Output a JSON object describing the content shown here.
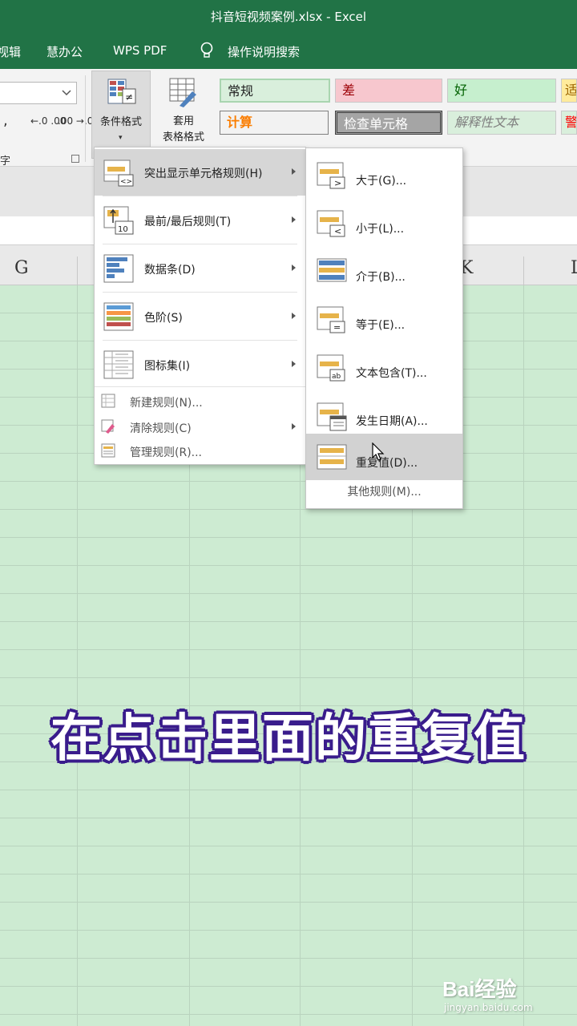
{
  "window": {
    "title": "抖音短视频案例.xlsx  -  Excel"
  },
  "menubar": {
    "items": [
      {
        "label": "视辑"
      },
      {
        "label": "慧办公"
      },
      {
        "label": "WPS PDF"
      },
      {
        "label": "操作说明搜索"
      }
    ]
  },
  "ribbon": {
    "number_group_label": "字",
    "comma_label": ",",
    "dec_increase": "←.0 .00",
    "dec_decrease": ".00 →.0",
    "conditional_format": {
      "label": "条件格式"
    },
    "table_format": {
      "label1": "套用",
      "label2": "表格格式"
    },
    "styles": [
      {
        "label": "常规",
        "bg": "#d9efdc",
        "color": "#222222"
      },
      {
        "label": "差",
        "bg": "#f7c7ce",
        "color": "#9c0006"
      },
      {
        "label": "好",
        "bg": "#c6efce",
        "color": "#006100"
      },
      {
        "label": "适",
        "bg": "#ffeb9c",
        "color": "#9c6500"
      },
      {
        "label": "计算",
        "bg": "#f2f2f2",
        "color": "#fa7d00"
      },
      {
        "label": "检查单元格",
        "bg": "#a5a5a5",
        "color": "#ffffff"
      },
      {
        "label": "解释性文本",
        "bg": "#d9efdc",
        "color": "#7f7f7f"
      },
      {
        "label": "警",
        "bg": "#d9efdc",
        "color": "#ff0000"
      }
    ]
  },
  "columns": {
    "g": "G",
    "k": "K",
    "l": "L"
  },
  "menu_main": {
    "items": [
      {
        "label": "突出显示单元格规则(H)"
      },
      {
        "label": "最前/最后规则(T)"
      },
      {
        "label": "数据条(D)"
      },
      {
        "label": "色阶(S)"
      },
      {
        "label": "图标集(I)"
      }
    ],
    "small_items": [
      {
        "label": "新建规则(N)..."
      },
      {
        "label": "清除规则(C)"
      },
      {
        "label": "管理规则(R)..."
      }
    ]
  },
  "menu_sub": {
    "items": [
      {
        "label": "大于(G)..."
      },
      {
        "label": "小于(L)..."
      },
      {
        "label": "介于(B)..."
      },
      {
        "label": "等于(E)..."
      },
      {
        "label": "文本包含(T)..."
      },
      {
        "label": "发生日期(A)..."
      },
      {
        "label": "重复值(D)..."
      }
    ],
    "more": "其他规则(M)..."
  },
  "caption": "在点击里面的重复值",
  "watermark": {
    "brand": "Bai经验",
    "url": "jingyan.baidu.com"
  },
  "colors": {
    "excel_green": "#217346",
    "grid_bg": "#cdebd2",
    "caption_outline": "#3a1d8c"
  }
}
